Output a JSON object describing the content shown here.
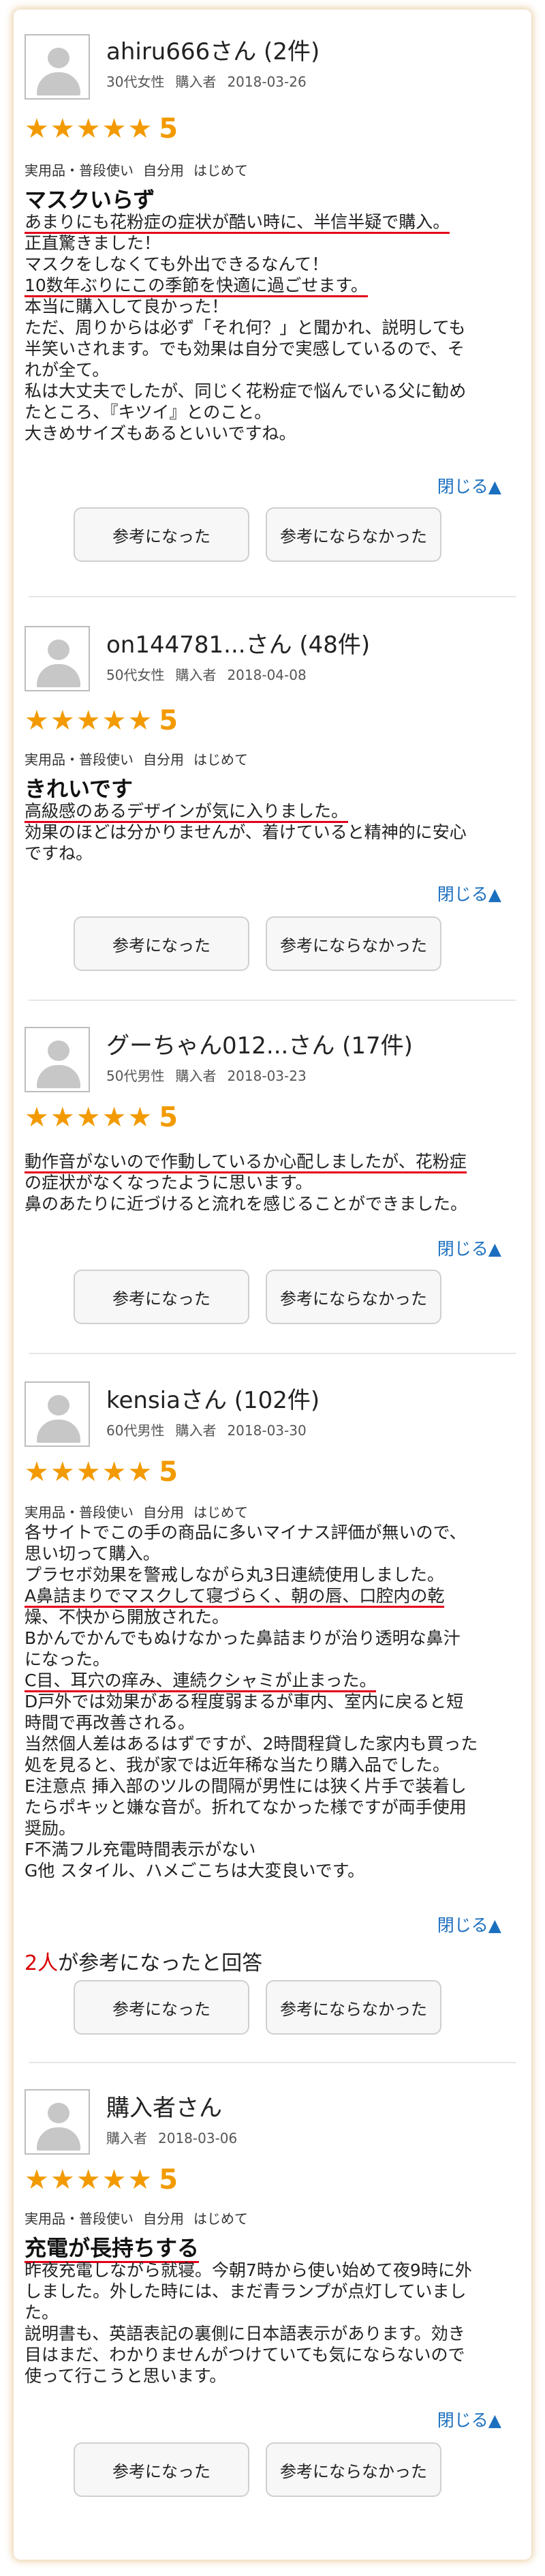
{
  "labels": {
    "close": "閉じる▲",
    "helpful_button": "参考になった",
    "not_helpful_button": "参考にならなかった",
    "helpful_suffix": "が参考になったと回答"
  },
  "colors": {
    "star": "#f29a00",
    "highlight": "#e3001b",
    "link": "#1b6fbf",
    "frame_glow": "#d6a050"
  },
  "icons": {
    "avatar": "default-user-avatar-icon",
    "close_arrow": "triangle-up-icon",
    "star": "star-icon"
  },
  "reviews": [
    {
      "name": "ahiru666さん (2件)",
      "demographic": "30代女性",
      "buyer": "購入者",
      "date": "2018-03-26",
      "stars": "★★★★★",
      "score": "5",
      "tags": [
        "実用品・普段使い",
        "自分用",
        "はじめて"
      ],
      "title": "マスクいらず",
      "lines": [
        "あまりにも花粉症の症状が酷い時に、半信半疑で購入。",
        "正直驚きました！",
        "マスクをしなくても外出できるなんて！",
        "10数年ぶりにこの季節を快適に過ごせます。",
        "本当に購入して良かった！",
        "ただ、周りからは必ず「それ何？」と聞かれ、説明しても",
        "半笑いされます。でも効果は自分で実感しているので、そ",
        "れが全て。",
        "私は大丈夫でしたが、同じく花粉症で悩んでいる父に勧め",
        "たところ、『キツイ』とのこと。",
        "大きめサイズもあるといいですね。"
      ]
    },
    {
      "name": "on144781...さん (48件)",
      "demographic": "50代女性",
      "buyer": "購入者",
      "date": "2018-04-08",
      "stars": "★★★★★",
      "score": "5",
      "tags": [
        "実用品・普段使い",
        "自分用",
        "はじめて"
      ],
      "title": "きれいです",
      "lines": [
        "高級感のあるデザインが気に入りました。",
        "効果のほどは分かりませんが、着けていると精神的に安心",
        "ですね。"
      ]
    },
    {
      "name": "グーちゃん012...さん (17件)",
      "demographic": "50代男性",
      "buyer": "購入者",
      "date": "2018-03-23",
      "stars": "★★★★★",
      "score": "5",
      "lines": [
        "動作音がないので作動しているか心配しましたが、花粉症",
        "の症状がなくなったように思います。",
        "鼻のあたりに近づけると流れを感じることができました。"
      ]
    },
    {
      "name": "kensiaさん (102件)",
      "demographic": "60代男性",
      "buyer": "購入者",
      "date": "2018-03-30",
      "stars": "★★★★★",
      "score": "5",
      "tags": [
        "実用品・普段使い",
        "自分用",
        "はじめて"
      ],
      "lines": [
        "各サイトでこの手の商品に多いマイナス評価が無いので、",
        "思い切って購入。",
        "プラセボ効果を警戒しながら丸3日連続使用しました。",
        "A鼻詰まりでマスクして寝づらく、朝の唇、口腔内の乾",
        "燥、不快から開放された。",
        "Bかんでかんでもぬけなかった鼻詰まりが治り透明な鼻汁",
        "になった。",
        "C目、耳穴の痒み、連続クシャミが止まった。",
        "D戸外では効果がある程度弱まるが車内、室内に戻ると短",
        "時間で再改善される。",
        "当然個人差はあるはずですが、2時間程貸した家内も買った",
        "処を見ると、我が家では近年稀な当たり購入品でした。",
        "E注意点 挿入部のツルの間隔が男性には狭く片手で装着し",
        "たらポキッと嫌な音が。折れてなかった様ですが両手使用",
        "奨励。",
        "F不満フル充電時間表示がない",
        "G他 スタイル、ハメごこちは大変良いです。"
      ],
      "helpful_count": "2人"
    },
    {
      "name": "購入者さん",
      "buyer": "購入者",
      "date": "2018-03-06",
      "stars": "★★★★★",
      "score": "5",
      "tags": [
        "実用品・普段使い",
        "自分用",
        "はじめて"
      ],
      "title": "充電が長持ちする",
      "lines": [
        "昨夜充電しながら就寝。今朝7時から使い始めて夜9時に外",
        "しました。外した時には、まだ青ランプが点灯していまし",
        "た。",
        "説明書も、英語表記の裏側に日本語表示があります。効き",
        "目はまだ、わかりませんがつけていても気にならないので",
        "使って行こうと思います。"
      ]
    }
  ]
}
